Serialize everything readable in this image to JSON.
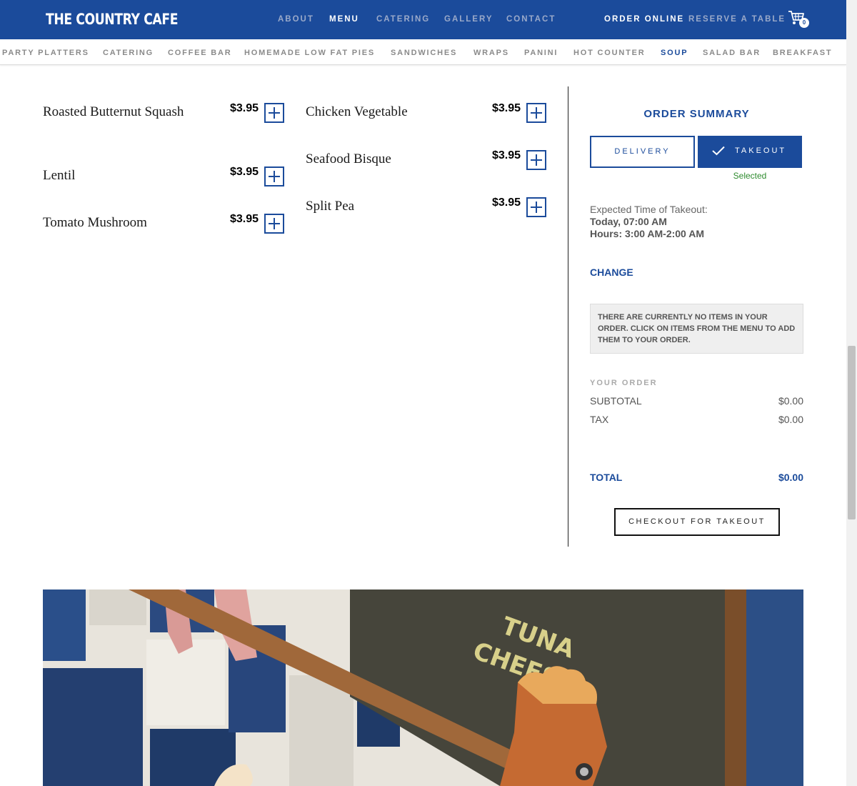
{
  "header": {
    "logo": "THE COUNTRY CAFE",
    "nav": [
      {
        "label": "ABOUT"
      },
      {
        "label": "MENU"
      },
      {
        "label": "CATERING"
      },
      {
        "label": "GALLERY"
      },
      {
        "label": "CONTACT"
      }
    ],
    "order_online": "ORDER ONLINE",
    "reserve": "RESERVE A TABLE",
    "cart_count": "0"
  },
  "categories": [
    {
      "label": "PARTY PLATTERS"
    },
    {
      "label": "CATERING"
    },
    {
      "label": "COFFEE BAR"
    },
    {
      "label": "HOMEMADE LOW FAT PIES"
    },
    {
      "label": "SANDWICHES"
    },
    {
      "label": "WRAPS"
    },
    {
      "label": "PANINI"
    },
    {
      "label": "HOT COUNTER"
    },
    {
      "label": "SOUP"
    },
    {
      "label": "SALAD BAR"
    },
    {
      "label": "BREAKFAST"
    }
  ],
  "menu": {
    "items": [
      {
        "name": "Roasted Butternut Squash",
        "price": "$3.95"
      },
      {
        "name": "Lentil",
        "price": "$3.95"
      },
      {
        "name": "Tomato Mushroom",
        "price": "$3.95"
      },
      {
        "name": "Chicken Vegetable",
        "price": "$3.95"
      },
      {
        "name": "Seafood Bisque",
        "price": "$3.95"
      },
      {
        "name": "Split Pea",
        "price": "$3.95"
      }
    ]
  },
  "summary": {
    "title": "ORDER SUMMARY",
    "delivery": "DELIVERY",
    "takeout": "TAKEOUT",
    "selected": "Selected",
    "expected_label": "Expected Time of Takeout:",
    "expected_time": "Today, 07:00 AM",
    "hours": "Hours: 3:00 AM-2:00 AM",
    "change": "CHANGE",
    "notice": "THERE ARE CURRENTLY NO ITEMS IN YOUR ORDER. CLICK ON ITEMS FROM THE MENU TO ADD THEM TO YOUR ORDER.",
    "your_order": "YOUR ORDER",
    "subtotal_label": "SUBTOTAL",
    "subtotal": "$0.00",
    "tax_label": "TAX",
    "tax": "$0.00",
    "total_label": "TOTAL",
    "total": "$0.00",
    "checkout": "CHECKOUT FOR TAKEOUT"
  },
  "photo": {
    "chalk_lines": [
      "TUNA",
      "CHEESE"
    ]
  },
  "colors": {
    "brand_blue": "#1b4b9b",
    "selected_green": "#2e8b2e"
  }
}
